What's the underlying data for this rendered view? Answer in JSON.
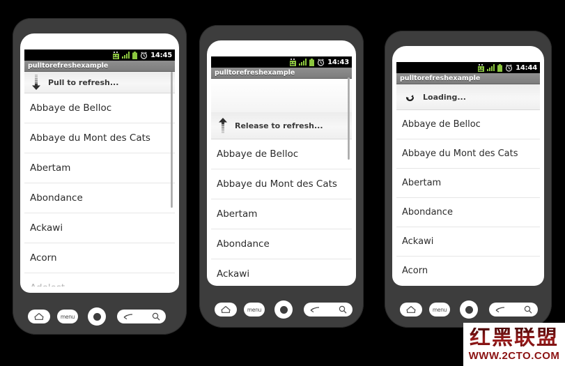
{
  "app": {
    "title": "pulltorefreshexample"
  },
  "status_bar": {
    "icons": [
      "usb-debug-icon",
      "signal-bars-icon",
      "battery-icon",
      "alarm-clock-icon"
    ],
    "times": [
      "14:45",
      "14:43",
      "14:44"
    ],
    "accent_green": "#8cc63f",
    "background": "#000000"
  },
  "hardware_keys": {
    "home_label": "home-icon",
    "menu_label": "menu",
    "trackball_label": "trackball-button",
    "back_label": "back-icon",
    "search_label": "search-icon"
  },
  "phones": [
    {
      "id": "phone-pull",
      "time": "14:45",
      "header": {
        "state": "pull",
        "label": "Pull to refresh...",
        "icon": "arrow-down-icon"
      },
      "items": [
        "Abbaye de Belloc",
        "Abbaye du Mont des Cats",
        "Abertam",
        "Abondance",
        "Ackawi",
        "Acorn",
        "Adelost"
      ]
    },
    {
      "id": "phone-release",
      "time": "14:43",
      "header": {
        "state": "release",
        "label": "Release to refresh...",
        "icon": "arrow-up-icon"
      },
      "items": [
        "Abbaye de Belloc",
        "Abbaye du Mont des Cats",
        "Abertam",
        "Abondance",
        "Ackawi"
      ]
    },
    {
      "id": "phone-loading",
      "time": "14:44",
      "header": {
        "state": "loading",
        "label": "Loading...",
        "icon": "refresh-spinner-icon"
      },
      "items": [
        "Abbaye de Belloc",
        "Abbaye du Mont des Cats",
        "Abertam",
        "Abondance",
        "Ackawi",
        "Acorn"
      ]
    }
  ],
  "watermark": {
    "cn": "红黑联盟",
    "url": "WWW.2CTO.COM",
    "color": "#8c1313"
  }
}
